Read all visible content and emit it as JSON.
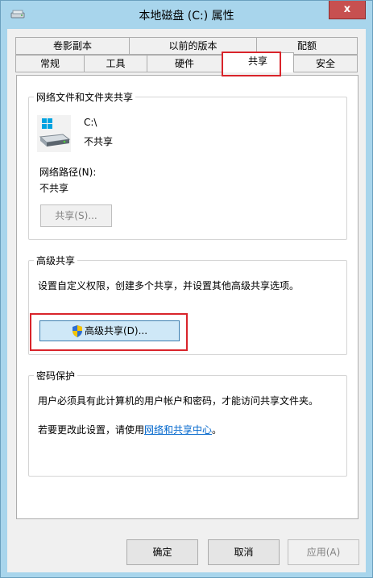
{
  "window": {
    "title": "本地磁盘 (C:) 属性",
    "close_label": "x"
  },
  "tabs_row1": [
    {
      "label": "卷影副本"
    },
    {
      "label": "以前的版本"
    },
    {
      "label": "配额"
    }
  ],
  "tabs_row2": [
    {
      "label": "常规"
    },
    {
      "label": "工具"
    },
    {
      "label": "硬件"
    },
    {
      "label": "共享"
    },
    {
      "label": "安全"
    }
  ],
  "network_sharing": {
    "group_title": "网络文件和文件夹共享",
    "drive_name": "C:\\",
    "share_state": "不共享",
    "path_label": "网络路径(N):",
    "path_value": "不共享",
    "share_button": "共享(S)..."
  },
  "advanced_sharing": {
    "group_title": "高级共享",
    "description": "设置自定义权限，创建多个共享，并设置其他高级共享选项。",
    "button": "高级共享(D)..."
  },
  "password_protection": {
    "group_title": "密码保护",
    "description": "用户必须具有此计算机的用户帐户和密码，才能访问共享文件夹。",
    "change_prefix": "若要更改此设置，请使用",
    "link": "网络和共享中心",
    "change_suffix": "。"
  },
  "footer": {
    "ok": "确定",
    "cancel": "取消",
    "apply": "应用(A)"
  }
}
